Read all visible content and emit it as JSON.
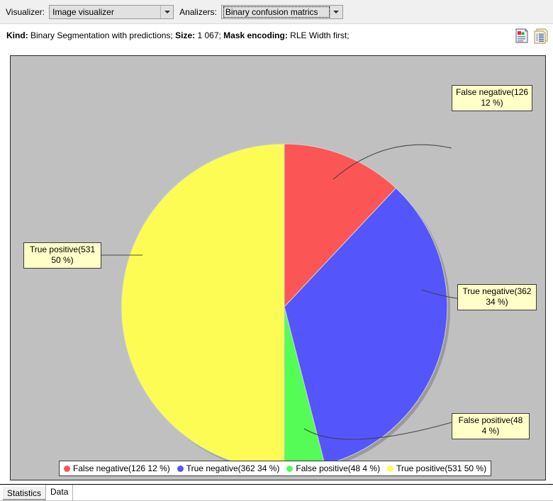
{
  "toolbar": {
    "visualizer_label": "Visualizer:",
    "visualizer_value": "Image visualizer",
    "analizers_label": "Analizers:",
    "analizers_value": "Binary confusion matrics"
  },
  "info": {
    "kind_label": "Kind:",
    "kind_value": " Binary Segmentation with predictions; ",
    "size_label": "Size:",
    "size_value": " 1 067; ",
    "mask_label": "Mask encoding:",
    "mask_value": " RLE Width first;",
    "report_icon_title": "report-icon",
    "copy_icon_title": "copy-icon"
  },
  "callouts": {
    "false_negative": "False negative(126\n12 %)",
    "true_positive": "True positive(531\n50 %)",
    "true_negative": "True negative(362\n34 %)",
    "false_positive": "False positive(48\n4 %)"
  },
  "legend": {
    "items": [
      {
        "label": "False negative(126 12 %)",
        "color": "#fc5555"
      },
      {
        "label": "True negative(362 34 %)",
        "color": "#5555fc"
      },
      {
        "label": "False positive(48 4 %)",
        "color": "#55fc55"
      },
      {
        "label": "True positive(531 50 %)",
        "color": "#fcfc55"
      }
    ]
  },
  "tabs": {
    "statistics": "Statistics",
    "data": "Data"
  },
  "chart_data": {
    "type": "pie",
    "title": "Binary confusion matrics",
    "categories": [
      "False negative",
      "True negative",
      "False positive",
      "True positive"
    ],
    "values": [
      126,
      362,
      48,
      531
    ],
    "percentages": [
      12,
      34,
      4,
      50
    ],
    "colors": [
      "#fc5555",
      "#5555fc",
      "#55fc55",
      "#fcfc55"
    ],
    "total": 1067,
    "start_angle_deg": 0,
    "direction": "clockwise",
    "legend_position": "bottom",
    "grid": false,
    "labels": [
      "False negative(126 12 %)",
      "True negative(362 34 %)",
      "False positive(48 4 %)",
      "True positive(531 50 %)"
    ],
    "plot_background": "#c0c0c0"
  }
}
